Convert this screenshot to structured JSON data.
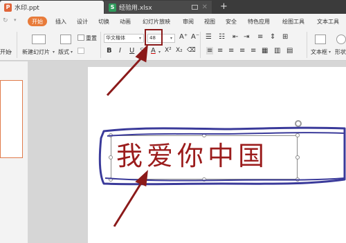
{
  "tabs": [
    {
      "label": "水印.ppt",
      "icon": "ppt-file-icon"
    },
    {
      "label": "经验用.xlsx",
      "icon": "xlsx-file-icon"
    }
  ],
  "menu": {
    "start": "开始",
    "items": [
      "插入",
      "设计",
      "切换",
      "动画",
      "幻灯片放映",
      "审阅",
      "视图",
      "安全",
      "特色应用",
      "绘图工具",
      "文本工具"
    ]
  },
  "ribbon": {
    "start_label": "开始",
    "new_slide": "新建幻灯片",
    "layout": "版式",
    "reset": "重置",
    "font_name": "华文楷体",
    "font_size": "48",
    "textbox": "文本框",
    "shape": "形状"
  },
  "slide": {
    "text": "我爱你中国"
  },
  "colors": {
    "accent": "#e87b3a",
    "slide_text": "#9b1c1c",
    "annotation": "#8b1a1a",
    "scribble": "#3a3a9a"
  }
}
